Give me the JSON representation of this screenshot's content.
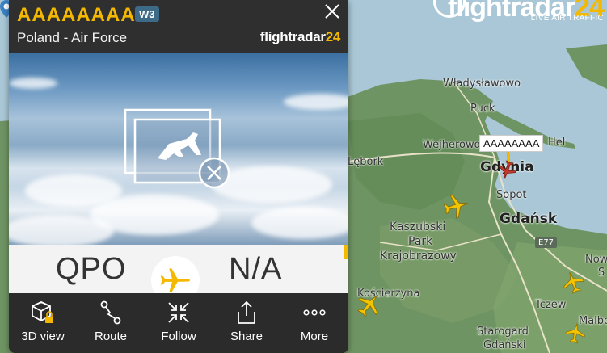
{
  "flight": {
    "callsign": "AAAAAAAA",
    "badge": "W3",
    "operator": "Poland - Air Force",
    "origin": "QPO",
    "destination": "N/A"
  },
  "panel_brand": {
    "main": "flightradar",
    "accent": "24"
  },
  "brand": {
    "main": "flightradar",
    "accent": "24",
    "tagline": "LIVE AIR TRAFFIC"
  },
  "toolbar": [
    {
      "label": "3D view",
      "icon": "cube-lock-icon"
    },
    {
      "label": "Route",
      "icon": "route-icon"
    },
    {
      "label": "Follow",
      "icon": "follow-arrows-icon"
    },
    {
      "label": "Share",
      "icon": "share-icon"
    },
    {
      "label": "More",
      "icon": "more-dots-icon"
    }
  ],
  "map": {
    "places": {
      "wladyslawowo": "Władysławowo",
      "puck": "Puck",
      "wejherowo": "Wejherowo",
      "hel": "Hel",
      "lebork": "Lębork",
      "gdynia": "Gdynia",
      "sopot": "Sopot",
      "gdansk": "Gdańsk",
      "kaszubski": "Kaszubski",
      "park": "Park",
      "krajobrazowy": "Krajobrazowy",
      "koscierzyna": "Kościerzyna",
      "tczew": "Tczew",
      "starogard": "Starogard",
      "gdanski": "Gdański",
      "malbo": "Malbo",
      "nowy": "Nowy",
      "e77": "E77",
      "s": "S"
    },
    "selected_tag": "AAAAAAAA"
  },
  "colors": {
    "accent": "#f5b800",
    "panel": "#2b2b2b",
    "badge": "#3d6a86",
    "sea": "#a9c7d6",
    "land": "#6f9463"
  }
}
